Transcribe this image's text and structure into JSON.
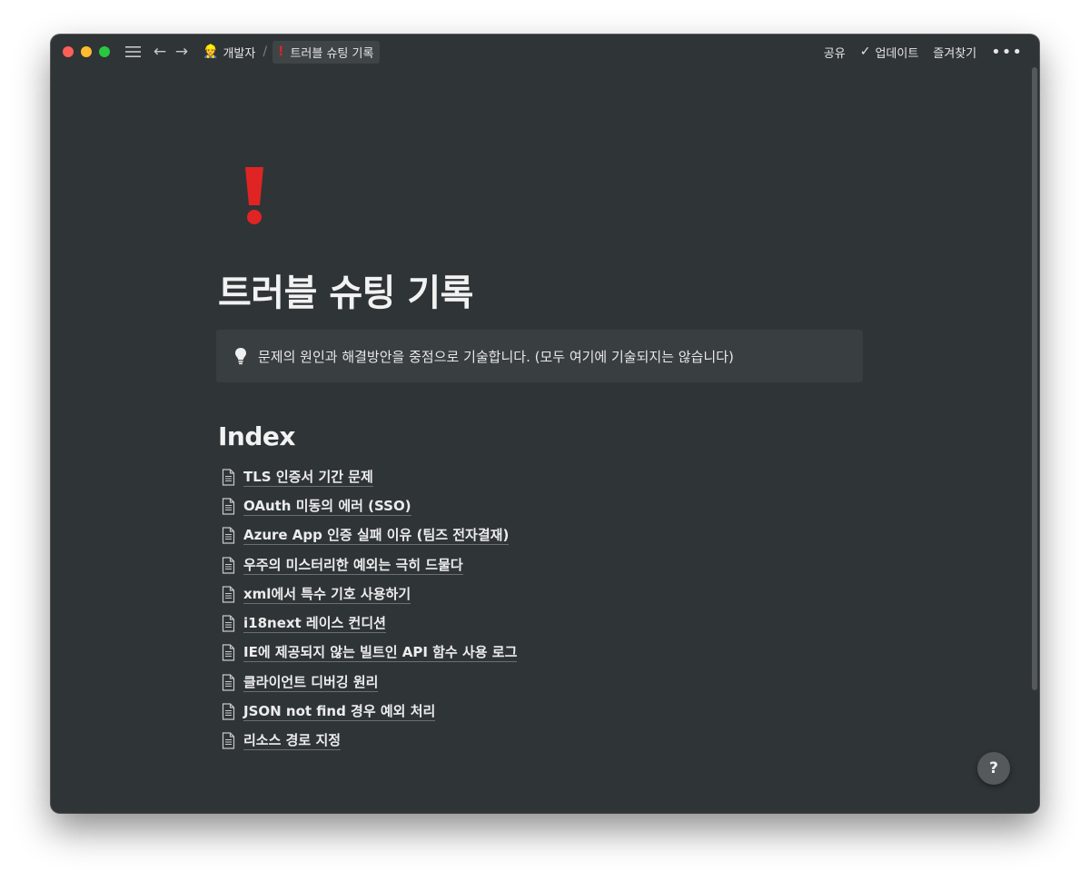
{
  "titlebar": {
    "breadcrumb": [
      {
        "emoji": "👷",
        "label": "개발자"
      },
      {
        "emoji": "❗",
        "label": "트러블 슈팅 기록"
      }
    ],
    "separator": "/",
    "share_label": "공유",
    "updates_label": "업데이트",
    "favorites_label": "즐겨찾기",
    "more_label": "•••"
  },
  "page": {
    "icon": "exclamation-icon",
    "icon_color": "#e02424",
    "title": "트러블 슈팅 기록",
    "callout": {
      "icon": "lightbulb-icon",
      "text": "문제의 원인과 해결방안을 중점으로 기술합니다. (모두 여기에 기술되지는 않습니다)"
    },
    "index_heading": "Index",
    "index_items": [
      {
        "label": "TLS 인증서 기간 문제"
      },
      {
        "label": "OAuth 미동의 에러 (SSO)"
      },
      {
        "label": "Azure App 인증 실패 이유 (팀즈 전자결재)"
      },
      {
        "label": "우주의 미스터리한 예외는 극히 드물다"
      },
      {
        "label": "xml에서 특수 기호 사용하기"
      },
      {
        "label": "i18next 레이스 컨디션"
      },
      {
        "label": "IE에 제공되지 않는 빌트인 API 함수 사용 로그"
      },
      {
        "label": "클라이언트 디버깅 원리"
      },
      {
        "label": "JSON not find 경우 예외 처리"
      },
      {
        "label": "리소스 경로 지정"
      }
    ]
  },
  "help_label": "?",
  "colors": {
    "background": "#2f3437",
    "callout_bg": "#393e41",
    "text": "#ececec",
    "accent_red": "#e02424"
  }
}
